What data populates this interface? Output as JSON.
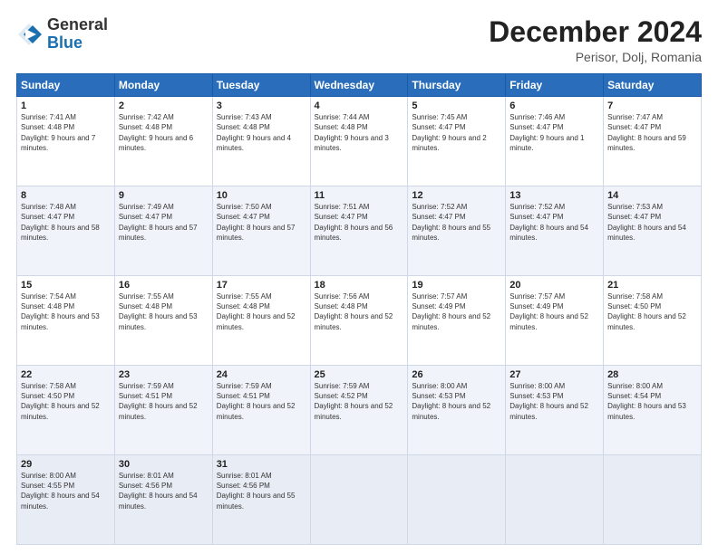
{
  "logo": {
    "general": "General",
    "blue": "Blue"
  },
  "header": {
    "month": "December 2024",
    "location": "Perisor, Dolj, Romania"
  },
  "weekdays": [
    "Sunday",
    "Monday",
    "Tuesday",
    "Wednesday",
    "Thursday",
    "Friday",
    "Saturday"
  ],
  "weeks": [
    [
      {
        "day": "1",
        "sunrise": "7:41 AM",
        "sunset": "4:48 PM",
        "daylight": "9 hours and 7 minutes."
      },
      {
        "day": "2",
        "sunrise": "7:42 AM",
        "sunset": "4:48 PM",
        "daylight": "9 hours and 6 minutes."
      },
      {
        "day": "3",
        "sunrise": "7:43 AM",
        "sunset": "4:48 PM",
        "daylight": "9 hours and 4 minutes."
      },
      {
        "day": "4",
        "sunrise": "7:44 AM",
        "sunset": "4:48 PM",
        "daylight": "9 hours and 3 minutes."
      },
      {
        "day": "5",
        "sunrise": "7:45 AM",
        "sunset": "4:47 PM",
        "daylight": "9 hours and 2 minutes."
      },
      {
        "day": "6",
        "sunrise": "7:46 AM",
        "sunset": "4:47 PM",
        "daylight": "9 hours and 1 minute."
      },
      {
        "day": "7",
        "sunrise": "7:47 AM",
        "sunset": "4:47 PM",
        "daylight": "8 hours and 59 minutes."
      }
    ],
    [
      {
        "day": "8",
        "sunrise": "7:48 AM",
        "sunset": "4:47 PM",
        "daylight": "8 hours and 58 minutes."
      },
      {
        "day": "9",
        "sunrise": "7:49 AM",
        "sunset": "4:47 PM",
        "daylight": "8 hours and 57 minutes."
      },
      {
        "day": "10",
        "sunrise": "7:50 AM",
        "sunset": "4:47 PM",
        "daylight": "8 hours and 57 minutes."
      },
      {
        "day": "11",
        "sunrise": "7:51 AM",
        "sunset": "4:47 PM",
        "daylight": "8 hours and 56 minutes."
      },
      {
        "day": "12",
        "sunrise": "7:52 AM",
        "sunset": "4:47 PM",
        "daylight": "8 hours and 55 minutes."
      },
      {
        "day": "13",
        "sunrise": "7:52 AM",
        "sunset": "4:47 PM",
        "daylight": "8 hours and 54 minutes."
      },
      {
        "day": "14",
        "sunrise": "7:53 AM",
        "sunset": "4:47 PM",
        "daylight": "8 hours and 54 minutes."
      }
    ],
    [
      {
        "day": "15",
        "sunrise": "7:54 AM",
        "sunset": "4:48 PM",
        "daylight": "8 hours and 53 minutes."
      },
      {
        "day": "16",
        "sunrise": "7:55 AM",
        "sunset": "4:48 PM",
        "daylight": "8 hours and 53 minutes."
      },
      {
        "day": "17",
        "sunrise": "7:55 AM",
        "sunset": "4:48 PM",
        "daylight": "8 hours and 52 minutes."
      },
      {
        "day": "18",
        "sunrise": "7:56 AM",
        "sunset": "4:48 PM",
        "daylight": "8 hours and 52 minutes."
      },
      {
        "day": "19",
        "sunrise": "7:57 AM",
        "sunset": "4:49 PM",
        "daylight": "8 hours and 52 minutes."
      },
      {
        "day": "20",
        "sunrise": "7:57 AM",
        "sunset": "4:49 PM",
        "daylight": "8 hours and 52 minutes."
      },
      {
        "day": "21",
        "sunrise": "7:58 AM",
        "sunset": "4:50 PM",
        "daylight": "8 hours and 52 minutes."
      }
    ],
    [
      {
        "day": "22",
        "sunrise": "7:58 AM",
        "sunset": "4:50 PM",
        "daylight": "8 hours and 52 minutes."
      },
      {
        "day": "23",
        "sunrise": "7:59 AM",
        "sunset": "4:51 PM",
        "daylight": "8 hours and 52 minutes."
      },
      {
        "day": "24",
        "sunrise": "7:59 AM",
        "sunset": "4:51 PM",
        "daylight": "8 hours and 52 minutes."
      },
      {
        "day": "25",
        "sunrise": "7:59 AM",
        "sunset": "4:52 PM",
        "daylight": "8 hours and 52 minutes."
      },
      {
        "day": "26",
        "sunrise": "8:00 AM",
        "sunset": "4:53 PM",
        "daylight": "8 hours and 52 minutes."
      },
      {
        "day": "27",
        "sunrise": "8:00 AM",
        "sunset": "4:53 PM",
        "daylight": "8 hours and 52 minutes."
      },
      {
        "day": "28",
        "sunrise": "8:00 AM",
        "sunset": "4:54 PM",
        "daylight": "8 hours and 53 minutes."
      }
    ],
    [
      {
        "day": "29",
        "sunrise": "8:00 AM",
        "sunset": "4:55 PM",
        "daylight": "8 hours and 54 minutes."
      },
      {
        "day": "30",
        "sunrise": "8:01 AM",
        "sunset": "4:56 PM",
        "daylight": "8 hours and 54 minutes."
      },
      {
        "day": "31",
        "sunrise": "8:01 AM",
        "sunset": "4:56 PM",
        "daylight": "8 hours and 55 minutes."
      },
      null,
      null,
      null,
      null
    ]
  ]
}
